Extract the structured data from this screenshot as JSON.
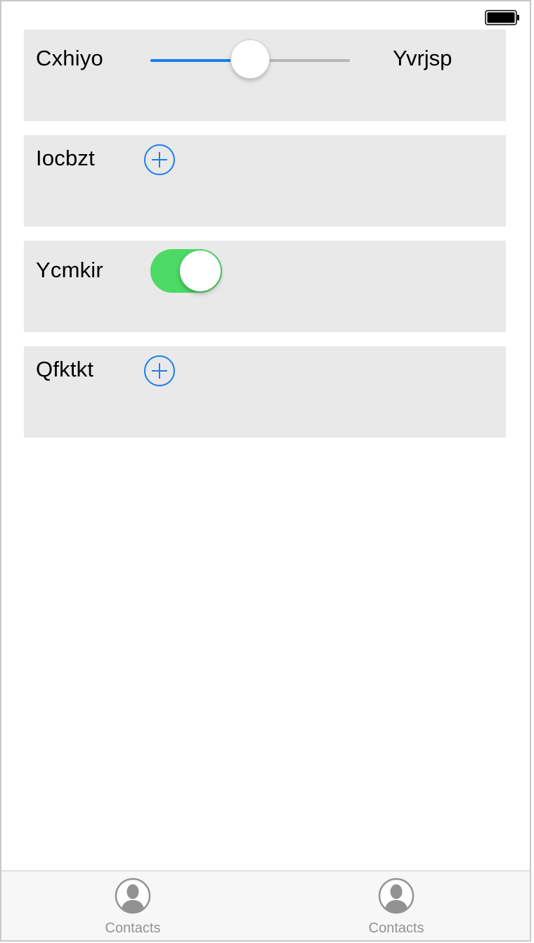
{
  "colors": {
    "accent": "#1a7ef2",
    "switch_on": "#4cd964",
    "card_background": "#e9e9e9",
    "tab_inactive": "#929292"
  },
  "slider_row": {
    "label": "Cxhiyo",
    "right_label": "Yvrjsp",
    "value": 0.5
  },
  "add_rows": [
    {
      "label": "Iocbzt",
      "icon": "plus-circle-icon"
    },
    {
      "label": "Qfktkt",
      "icon": "plus-circle-icon"
    }
  ],
  "switch_row": {
    "label": "Ycmkir",
    "on": true
  },
  "tab_bar": {
    "tabs": [
      {
        "label": "Contacts",
        "icon": "person-icon"
      },
      {
        "label": "Contacts",
        "icon": "person-icon"
      }
    ]
  },
  "status_bar": {
    "icon": "battery-icon"
  }
}
